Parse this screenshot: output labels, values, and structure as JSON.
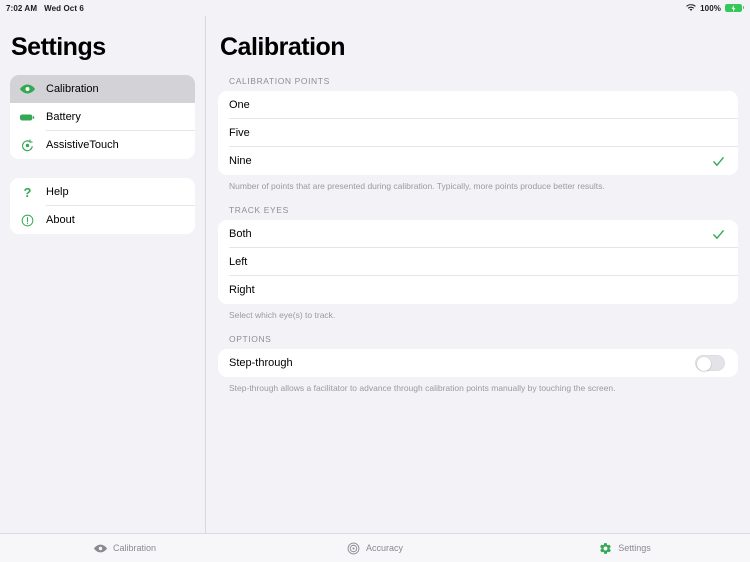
{
  "status_bar": {
    "time": "7:02 AM",
    "date": "Wed Oct 6",
    "battery_percent": "100%",
    "wifi_icon": "wifi-icon",
    "battery_icon": "battery-charging-icon",
    "accent_color": "#34c759"
  },
  "sidebar": {
    "title": "Settings",
    "groups": [
      {
        "items": [
          {
            "label": "Calibration",
            "icon": "eye-icon",
            "selected": true
          },
          {
            "label": "Battery",
            "icon": "battery-icon",
            "selected": false
          },
          {
            "label": "AssistiveTouch",
            "icon": "assistive-touch-icon",
            "selected": false
          }
        ]
      },
      {
        "items": [
          {
            "label": "Help",
            "icon": "question-mark-icon",
            "selected": false
          },
          {
            "label": "About",
            "icon": "info-circle-icon",
            "selected": false
          }
        ]
      }
    ]
  },
  "main": {
    "title": "Calibration",
    "sections": [
      {
        "header": "CALIBRATION POINTS",
        "rows": [
          {
            "label": "One",
            "checked": false
          },
          {
            "label": "Five",
            "checked": false
          },
          {
            "label": "Nine",
            "checked": true
          }
        ],
        "footer": "Number of points that are presented during calibration. Typically, more points produce better results."
      },
      {
        "header": "TRACK EYES",
        "rows": [
          {
            "label": "Both",
            "checked": true
          },
          {
            "label": "Left",
            "checked": false
          },
          {
            "label": "Right",
            "checked": false
          }
        ],
        "footer": "Select which eye(s) to track."
      },
      {
        "header": "OPTIONS",
        "rows": [
          {
            "label": "Step-through",
            "toggle": true,
            "toggle_on": false
          }
        ],
        "footer": "Step-through allows a facilitator to advance through calibration points manually by touching the screen."
      }
    ]
  },
  "tabbar": {
    "tabs": [
      {
        "label": "Calibration",
        "icon": "eye-icon",
        "active": false
      },
      {
        "label": "Accuracy",
        "icon": "target-icon",
        "active": false
      },
      {
        "label": "Settings",
        "icon": "gear-icon",
        "active": true
      }
    ]
  },
  "colors": {
    "accent_green": "#34a853",
    "background": "#f2f2f7",
    "card": "#ffffff",
    "selected_row": "#d2d2d7",
    "secondary_text": "#8e8e93"
  }
}
